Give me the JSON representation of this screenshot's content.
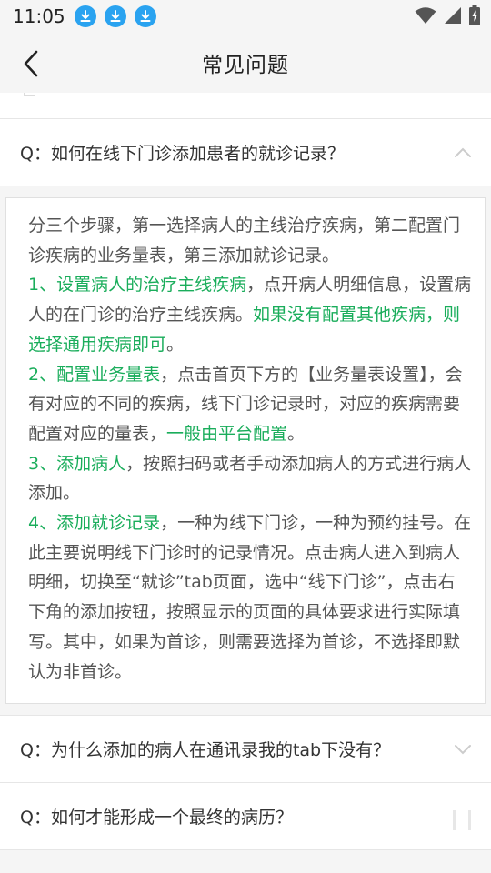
{
  "status_bar": {
    "time": "11:05",
    "download_icons": [
      "download-icon",
      "download-icon",
      "download-icon"
    ],
    "system_icons": [
      "wifi-icon",
      "cellular-icon",
      "battery-icon"
    ]
  },
  "nav": {
    "title": "常见问题"
  },
  "colors": {
    "accent_green": "#1aad5b",
    "download_blue": "#2aa3f0"
  },
  "faq": [
    {
      "question": "Q：如何在线下门诊添加患者的就诊记录？",
      "expanded": true
    },
    {
      "question": "Q：为什么添加的病人在通讯录我的tab下没有？",
      "expanded": false
    },
    {
      "question": "Q：如何才能形成一个最终的病历？",
      "expanded": false
    }
  ],
  "answer": {
    "intro": "分三个步骤，第一选择病人的主线治疗疾病，第二配置门诊疾病的业务量表，第三添加就诊记录。",
    "step1_title": "1、设置病人的治疗主线疾病",
    "step1_text": "，点开病人明细信息，设置病人的在门诊的治疗主线疾病。",
    "step1_note": "如果没有配置其他疾病，则选择通用疾病即可",
    "step1_end": "。",
    "step2_title": "2、配置业务量表",
    "step2_text": "，点击首页下方的【业务量表设置】，会有对应的不同的疾病，线下门诊记录时，对应的疾病需要配置对应的量表，",
    "step2_note": "一般由平台配置",
    "step2_end": "。",
    "step3_title": "3、添加病人",
    "step3_text": "，按照扫码或者手动添加病人的方式进行病人添加。",
    "step4_title": "4、添加就诊记录",
    "step4_text": "，一种为线下门诊，一种为预约挂号。在此主要说明线下门诊时的记录情况。点击病人进入到病人明细，切换至“就诊”tab页面，选中“线下门诊”，点击右下角的添加按钮，按照显示的页面的具体要求进行实际填写。其中，如果为首诊，则需要选择为首诊，不选择即默认为非首诊。"
  }
}
